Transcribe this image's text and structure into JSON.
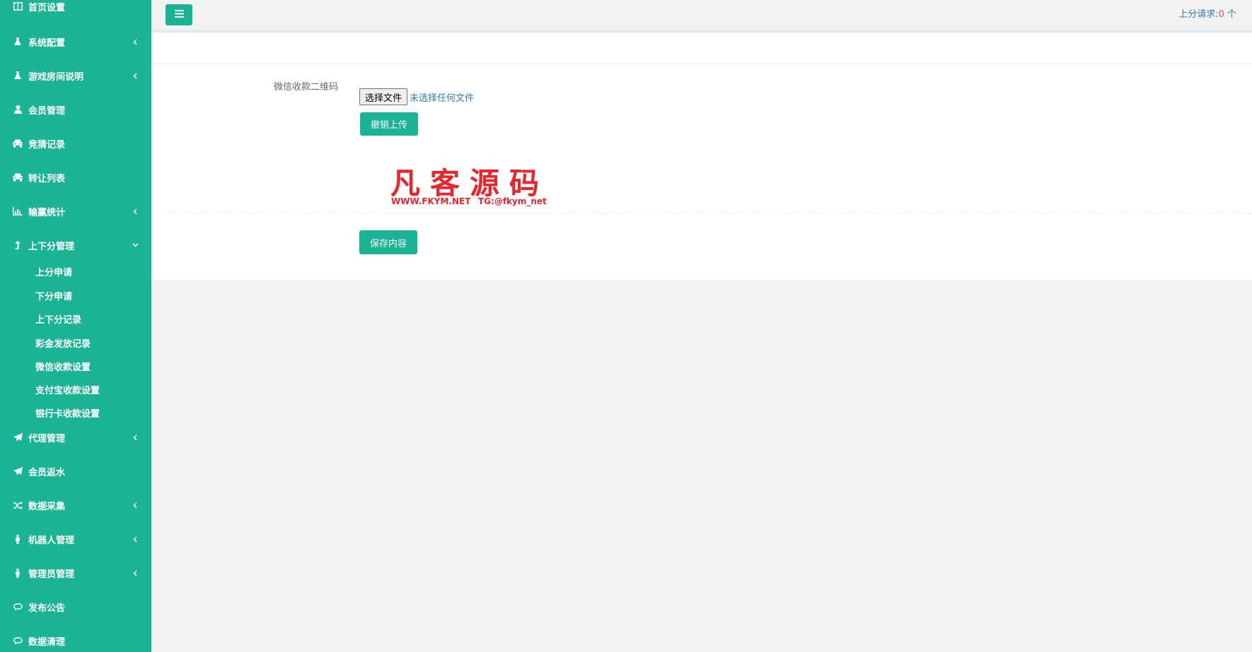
{
  "sidebar": {
    "items": [
      {
        "label": "首页设置",
        "icon": "columns-icon"
      },
      {
        "label": "系统配置",
        "icon": "flask-icon"
      },
      {
        "label": "游戏房间说明",
        "icon": "flask-icon"
      },
      {
        "label": "会员管理",
        "icon": "user-icon"
      },
      {
        "label": "竞猜记录",
        "icon": "car-icon"
      },
      {
        "label": "转让列表",
        "icon": "car-icon"
      },
      {
        "label": "输赢统计",
        "icon": "bar-chart-icon"
      },
      {
        "label": "上下分管理",
        "icon": "level-up-icon"
      },
      {
        "label": "代理管理",
        "icon": "paper-plane-icon"
      },
      {
        "label": "会员返水",
        "icon": "paper-plane-icon"
      },
      {
        "label": "数据采集",
        "icon": "random-icon"
      },
      {
        "label": "机器人管理",
        "icon": "male-icon"
      },
      {
        "label": "管理员管理",
        "icon": "male-icon"
      },
      {
        "label": "发布公告",
        "icon": "comment-icon"
      },
      {
        "label": "数据清理",
        "icon": "comment-icon"
      }
    ],
    "subitems": [
      {
        "label": "上分申请"
      },
      {
        "label": "下分申请"
      },
      {
        "label": "上下分记录"
      },
      {
        "label": "彩金发放记录"
      },
      {
        "label": "微信收款设置"
      },
      {
        "label": "支付宝收款设置"
      },
      {
        "label": "银行卡收款设置"
      }
    ]
  },
  "topbar": {
    "request_label": "上分请求:",
    "request_count": "0",
    "request_unit": " 个"
  },
  "form": {
    "label": "微信收款二维码",
    "file_button": "选择文件",
    "file_status": "未选择任何文件",
    "cancel_upload": "撤销上传",
    "save": "保存内容"
  },
  "image": {
    "title": "凡客源码",
    "url_text": "WWW.FKYM.NET",
    "tg_text": "TG:@fkym_net"
  },
  "colors": {
    "brand": "#1ab394",
    "link": "#337ab7",
    "count": "#ed5565",
    "watermark": "#e8262d"
  }
}
